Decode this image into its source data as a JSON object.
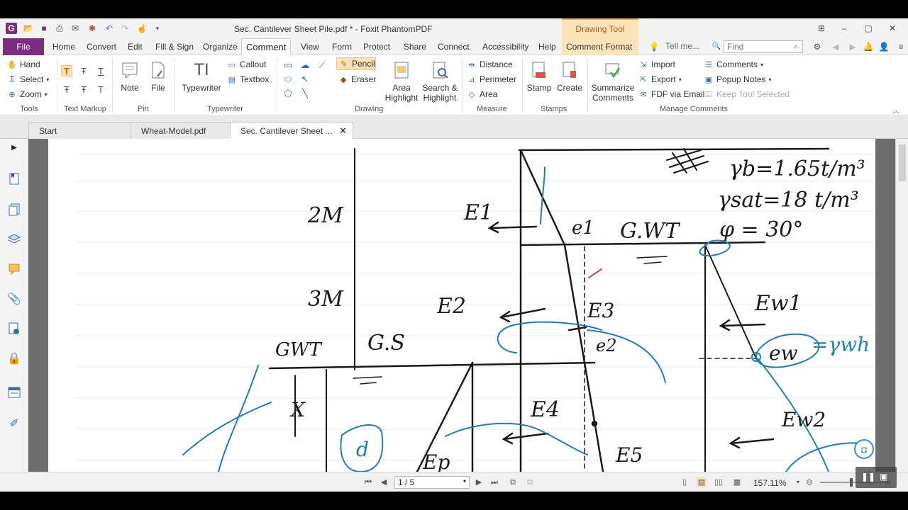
{
  "window": {
    "title": "Sec. Cantilever Sheet Pile.pdf * - Foxit PhantomPDF",
    "context_tab": "Drawing Tool"
  },
  "tabs": [
    "File",
    "Home",
    "Convert",
    "Edit",
    "Fill & Sign",
    "Organize",
    "Comment",
    "View",
    "Form",
    "Protect",
    "Share",
    "Connect",
    "Accessibility",
    "Help",
    "Comment Format"
  ],
  "tellme": "Tell me...",
  "find": {
    "placeholder": "Find"
  },
  "ribbon": {
    "tools": {
      "label": "Tools",
      "hand": "Hand",
      "select": "Select",
      "zoom": "Zoom"
    },
    "text_markup": {
      "label": "Text Markup"
    },
    "pin": {
      "label": "Pin",
      "note": "Note",
      "file": "File"
    },
    "typewriter": {
      "label": "Typewriter",
      "typewriter": "Typewriter",
      "callout": "Callout",
      "textbox": "Textbox"
    },
    "drawing": {
      "label": "Drawing",
      "pencil": "Pencil",
      "eraser": "Eraser",
      "area_highlight": [
        "Area",
        "Highlight"
      ],
      "search_highlight": [
        "Search &",
        "Highlight"
      ]
    },
    "measure": {
      "label": "Measure",
      "distance": "Distance",
      "perimeter": "Perimeter",
      "area": "Area"
    },
    "stamps": {
      "label": "Stamps",
      "stamp": "Stamp",
      "create": "Create"
    },
    "manage": {
      "label": "Manage Comments",
      "summarize": [
        "Summarize",
        "Comments"
      ],
      "import": "Import",
      "export": "Export",
      "fdf": "FDF via Email",
      "comments": "Comments",
      "popup": "Popup Notes",
      "keep": "Keep Tool Selected"
    }
  },
  "doctabs": [
    "Start",
    "Wheat-Model.pdf",
    "Sec. Cantilever Sheet ..."
  ],
  "drawing": {
    "labels": {
      "two_m": "2M",
      "three_m": "3M",
      "gwt_left": "GWT",
      "gs": "G.S",
      "gwt_right": "G.WT",
      "e1_big": "E1",
      "e2": "E2",
      "e3": "E3",
      "e4": "E4",
      "e5": "E5",
      "ep": "Ep",
      "ew1": "Ew1",
      "ew2": "Ew2",
      "ew_small": "ew",
      "e1_small": "e1",
      "e2_small": "e2",
      "x": "X",
      "d": "d",
      "gamma_b": "γb=1.65t/m³",
      "gamma_sat": "γsat=18 t/m³",
      "phi": "φ = 30°",
      "kw": "=γwh"
    }
  },
  "status": {
    "page": "1 / 5",
    "zoom": "157.11%"
  },
  "colors": {
    "file_tab": "#7a2e7e",
    "context_tab": "#fde4b8",
    "ink_black": "#1a1a1a",
    "ink_blue": "#1f7fb3"
  }
}
